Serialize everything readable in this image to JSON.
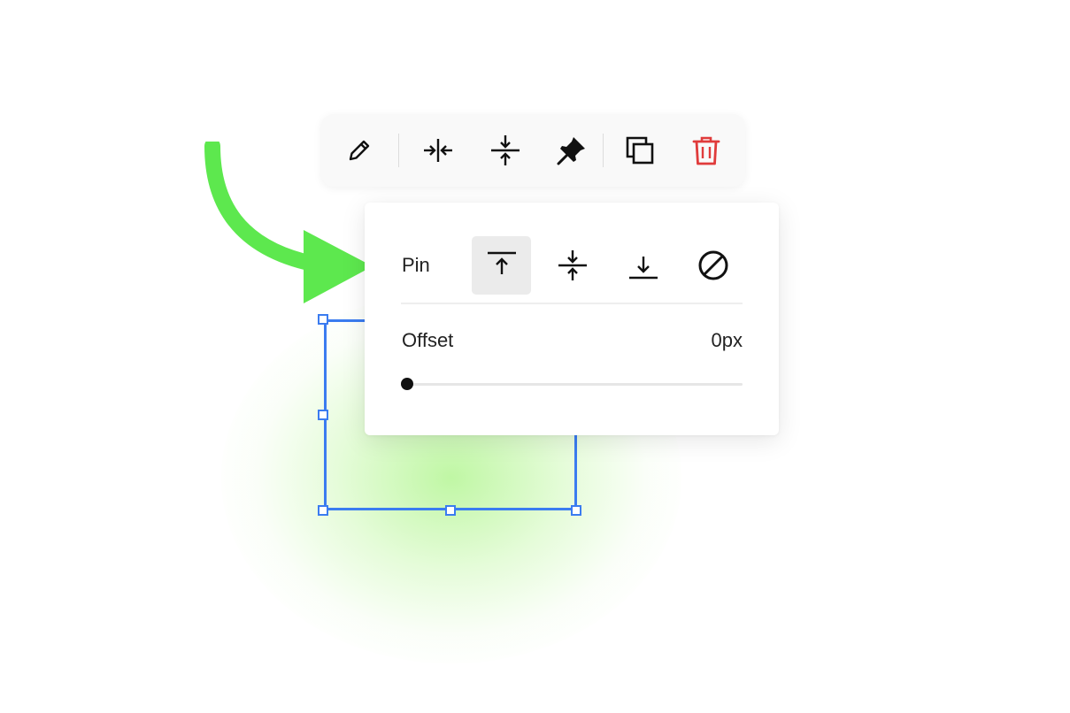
{
  "toolbar": {
    "buttons": [
      {
        "name": "edit",
        "icon": "pencil-icon"
      },
      {
        "name": "align-center-horizontal",
        "icon": "arrows-in-horizontal-icon"
      },
      {
        "name": "align-center-vertical",
        "icon": "arrows-in-vertical-icon"
      },
      {
        "name": "pin",
        "icon": "pin-icon"
      },
      {
        "name": "duplicate",
        "icon": "duplicate-icon"
      },
      {
        "name": "delete",
        "icon": "trash-icon"
      }
    ]
  },
  "pin_panel": {
    "pin_label": "Pin",
    "options": [
      {
        "name": "pin-top",
        "icon": "pin-top-icon",
        "selected": true
      },
      {
        "name": "pin-center",
        "icon": "pin-center-icon",
        "selected": false
      },
      {
        "name": "pin-bottom",
        "icon": "pin-bottom-icon",
        "selected": false
      },
      {
        "name": "pin-none",
        "icon": "prohibited-icon",
        "selected": false
      }
    ],
    "offset_label": "Offset",
    "offset_value": "0px",
    "offset_slider_fraction": 0
  },
  "colors": {
    "selection": "#3b7cf0",
    "arrow": "#5de84e",
    "delete": "#e03b3b",
    "active_option_bg": "#ebebeb"
  }
}
